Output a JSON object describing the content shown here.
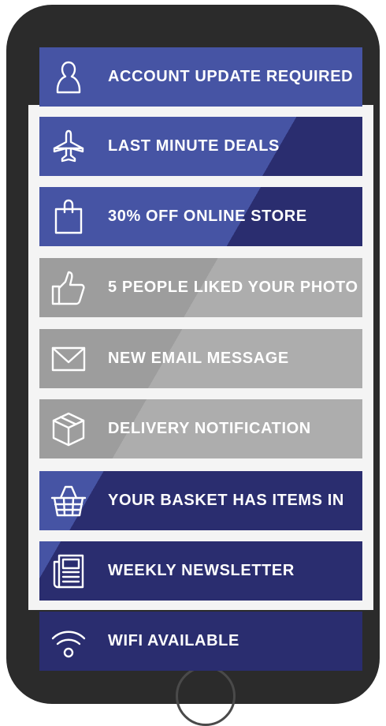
{
  "notifications": [
    {
      "label": "ACCOUNT UPDATE REQUIRED",
      "icon": "user-icon"
    },
    {
      "label": "LAST MINUTE DEALS",
      "icon": "airplane-icon"
    },
    {
      "label": "30% OFF ONLINE STORE",
      "icon": "shopping-bag-icon"
    },
    {
      "label": "5 PEOPLE LIKED YOUR PHOTO",
      "icon": "thumbs-up-icon"
    },
    {
      "label": "NEW EMAIL MESSAGE",
      "icon": "envelope-icon"
    },
    {
      "label": "DELIVERY NOTIFICATION",
      "icon": "package-icon"
    },
    {
      "label": "YOUR BASKET HAS ITEMS IN",
      "icon": "basket-icon"
    },
    {
      "label": "WEEKLY NEWSLETTER",
      "icon": "newspaper-icon"
    },
    {
      "label": "WIFI AVAILABLE",
      "icon": "wifi-icon"
    }
  ],
  "colors": {
    "primary_blue": "#4654a4",
    "dark_navy": "#2a2d6f",
    "grey": "#9d9d9d",
    "phone_body": "#2b2b2b"
  }
}
